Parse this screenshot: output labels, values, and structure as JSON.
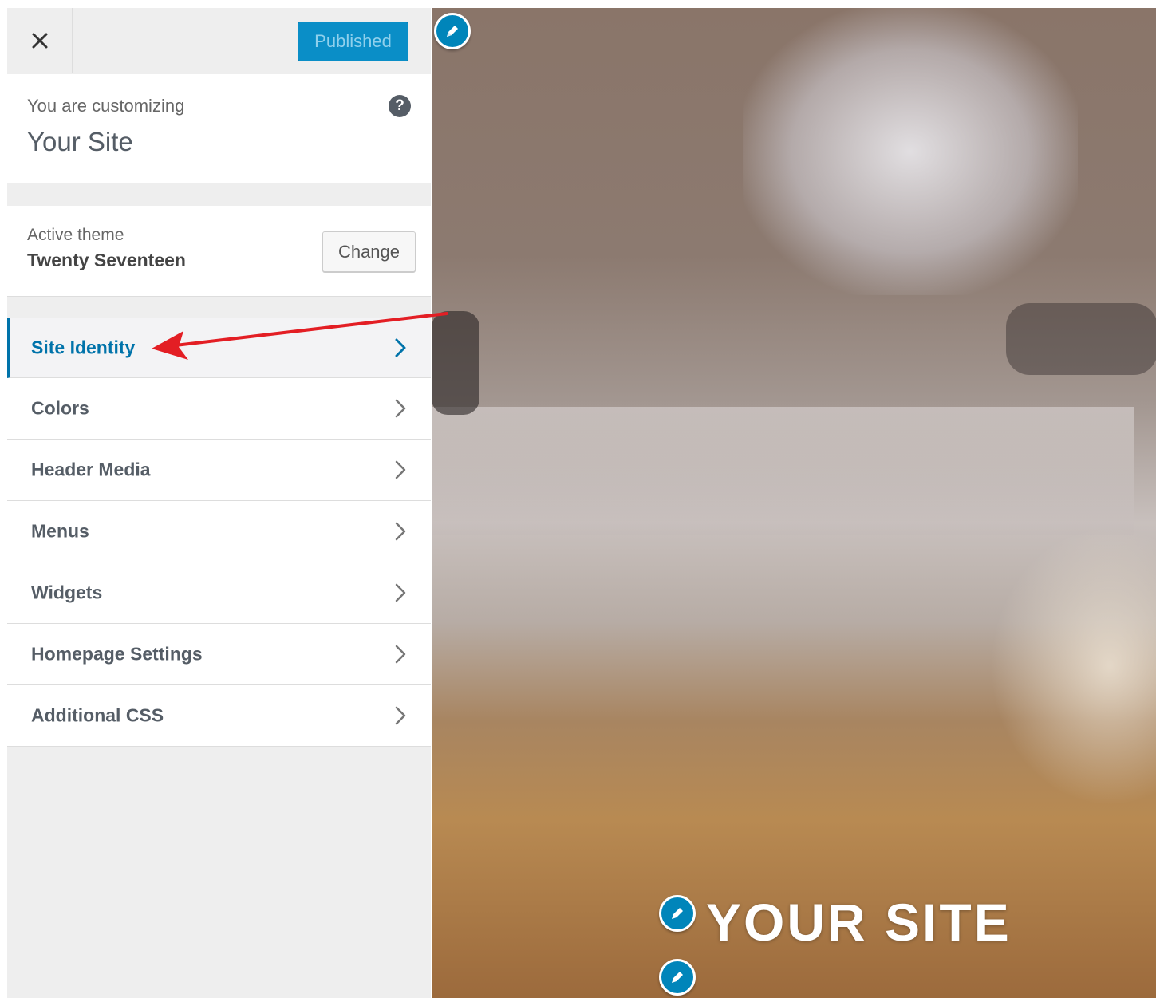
{
  "header": {
    "close_icon": "close-icon",
    "publish_label": "Published"
  },
  "info": {
    "customizing_label": "You are customizing",
    "site_title": "Your Site",
    "help_icon": "help-icon",
    "help_glyph": "?"
  },
  "theme": {
    "label": "Active theme",
    "name": "Twenty Seventeen",
    "change_label": "Change"
  },
  "sections": [
    {
      "label": "Site Identity",
      "active": true
    },
    {
      "label": "Colors"
    },
    {
      "label": "Header Media"
    },
    {
      "label": "Menus"
    },
    {
      "label": "Widgets"
    },
    {
      "label": "Homepage Settings"
    },
    {
      "label": "Additional CSS"
    }
  ],
  "preview": {
    "site_title": "YOUR SITE",
    "shortcut_icon": "pencil-icon"
  },
  "colors": {
    "accent": "#0073aa",
    "publish_bg": "#0a8ec7",
    "arrow": "#e31e24"
  }
}
